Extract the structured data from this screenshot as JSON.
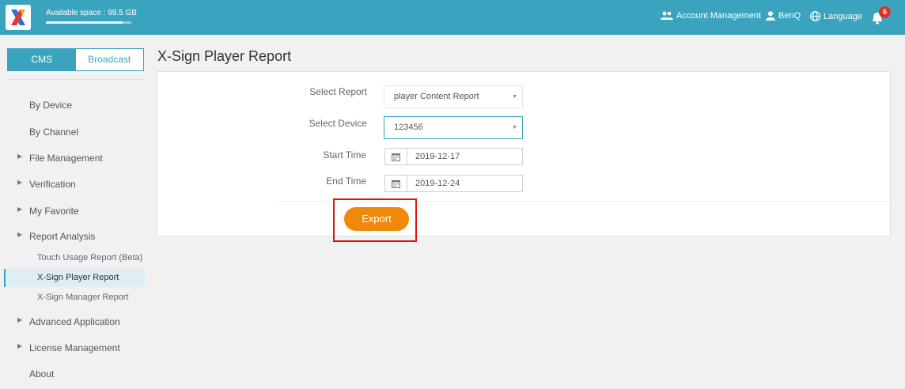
{
  "header": {
    "available_space": "Available space : 99.5 GB",
    "available_fraction": 0.9,
    "account_management": "Account Management",
    "user": "BenQ",
    "language": "Language",
    "notification_count": "6",
    "brand_color": "#3aa4bf"
  },
  "sidebar": {
    "toggle": {
      "cms": "CMS",
      "broadcast": "Broadcast",
      "active": "CMS"
    },
    "items": {
      "by_device": "By Device",
      "by_channel": "By Channel",
      "file_management": "File Management",
      "verification": "Verification",
      "my_favorite": "My Favorite",
      "report_analysis": "Report Analysis",
      "touch_usage": "Touch Usage Report (Beta)",
      "player_report": "X-Sign Player Report",
      "manager_report": "X-Sign Manager Report",
      "advanced_application": "Advanced Application",
      "license_management": "License Management",
      "about": "About"
    }
  },
  "main": {
    "title": "X-Sign Player Report",
    "form": {
      "select_report_label": "Select Report",
      "select_report_value": "player Content Report",
      "select_device_label": "Select Device",
      "select_device_value": "123456",
      "start_time_label": "Start Time",
      "start_time_value": "2019-12-17",
      "end_time_label": "End Time",
      "end_time_value": "2019-12-24"
    },
    "export_label": "Export",
    "export_color": "#f0890a"
  }
}
